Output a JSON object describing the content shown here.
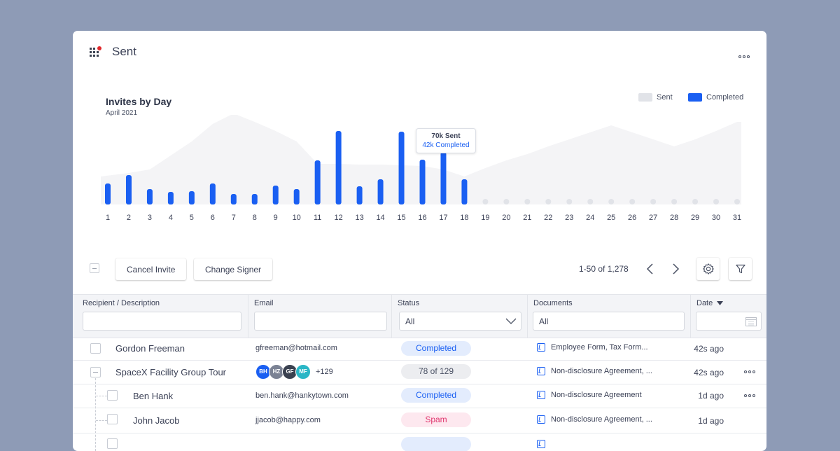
{
  "header": {
    "title": "Sent"
  },
  "chart_data": {
    "type": "bar",
    "title": "Invites by Day",
    "subtitle": "April 2021",
    "legend": [
      {
        "label": "Sent",
        "color": "#e1e3e8"
      },
      {
        "label": "Completed",
        "color": "#1a5ff2"
      }
    ],
    "legend_position": "top-right",
    "categories": [
      "1",
      "2",
      "3",
      "4",
      "5",
      "6",
      "7",
      "8",
      "9",
      "10",
      "11",
      "12",
      "13",
      "14",
      "15",
      "16",
      "17",
      "18",
      "19",
      "20",
      "21",
      "22",
      "23",
      "24",
      "25",
      "26",
      "27",
      "28",
      "29",
      "30",
      "31"
    ],
    "series": [
      {
        "name": "Sent",
        "type": "area",
        "values": [
          40,
          45,
          50,
          70,
          90,
          115,
          130,
          118,
          105,
          90,
          58,
          58,
          57,
          57,
          56,
          55,
          50,
          40,
          52,
          63,
          72,
          83,
          93,
          103,
          113,
          103,
          93,
          83,
          93,
          105,
          118
        ]
      },
      {
        "name": "Completed",
        "type": "bar",
        "values": [
          30,
          42,
          22,
          18,
          19,
          30,
          15,
          15,
          27,
          22,
          63,
          105,
          26,
          36,
          104,
          64,
          75,
          36,
          0,
          0,
          0,
          0,
          0,
          0,
          0,
          0,
          0,
          0,
          0,
          0,
          0
        ]
      }
    ],
    "tooltip": {
      "line1": "70k Sent",
      "line2": "42k Completed",
      "day": "17"
    }
  },
  "toolbar": {
    "cancel_label": "Cancel Invite",
    "change_label": "Change Signer",
    "pager_text": "1-50 of 1,278"
  },
  "table": {
    "columns": {
      "recipient": "Recipient / Description",
      "email": "Email",
      "status": "Status",
      "documents": "Documents",
      "date": "Date"
    },
    "filters": {
      "status": "All",
      "documents": "All"
    },
    "rows": [
      {
        "name": "Gordon Freeman",
        "email": "gfreeman@hotmail.com",
        "status": "Completed",
        "documents": "Employee Form, Tax Form...",
        "date": "42s ago"
      },
      {
        "name": "SpaceX Facility Group Tour",
        "avatars": [
          "BH",
          "HZ",
          "GF",
          "MF"
        ],
        "more": "+129",
        "status": "78 of 129",
        "documents": "Non-disclosure Agreement, ...",
        "date": "42s ago"
      },
      {
        "name": "Ben Hank",
        "email": "ben.hank@hankytown.com",
        "status": "Completed",
        "documents": "Non-disclosure Agreement",
        "date": "1d ago"
      },
      {
        "name": "John Jacob",
        "email": "jjacob@happy.com",
        "status": "Spam",
        "documents": "Non-disclosure Agreement, ...",
        "date": "1d ago"
      }
    ]
  },
  "colors": {
    "accent": "#1a5ff2",
    "area": "#f4f4f6",
    "dot": "#e1e3e8"
  }
}
